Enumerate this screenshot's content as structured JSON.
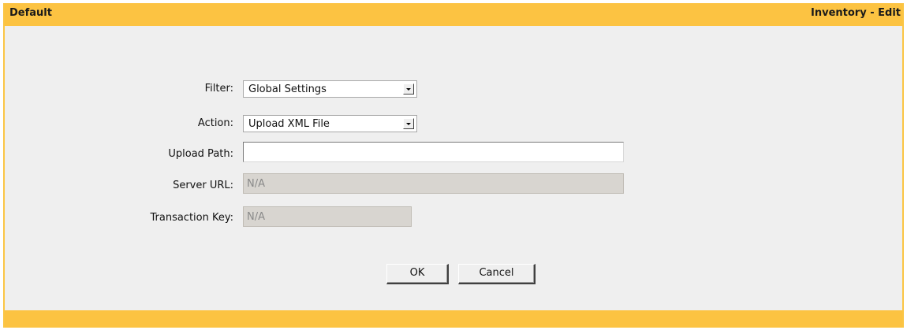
{
  "header": {
    "left_title": "Default",
    "right_title": "Inventory - Edit"
  },
  "form": {
    "filter": {
      "label": "Filter:",
      "value": "Global Settings"
    },
    "action": {
      "label": "Action:",
      "value": "Upload XML File"
    },
    "upload_path": {
      "label": "Upload Path:",
      "value": ""
    },
    "server_url": {
      "label": "Server URL:",
      "value": "N/A"
    },
    "transaction_key": {
      "label": "Transaction Key:",
      "value": "N/A"
    }
  },
  "buttons": {
    "ok_label": "OK",
    "cancel_label": "Cancel"
  },
  "colors": {
    "accent": "#fcc342",
    "panel_bg": "#efefef"
  }
}
